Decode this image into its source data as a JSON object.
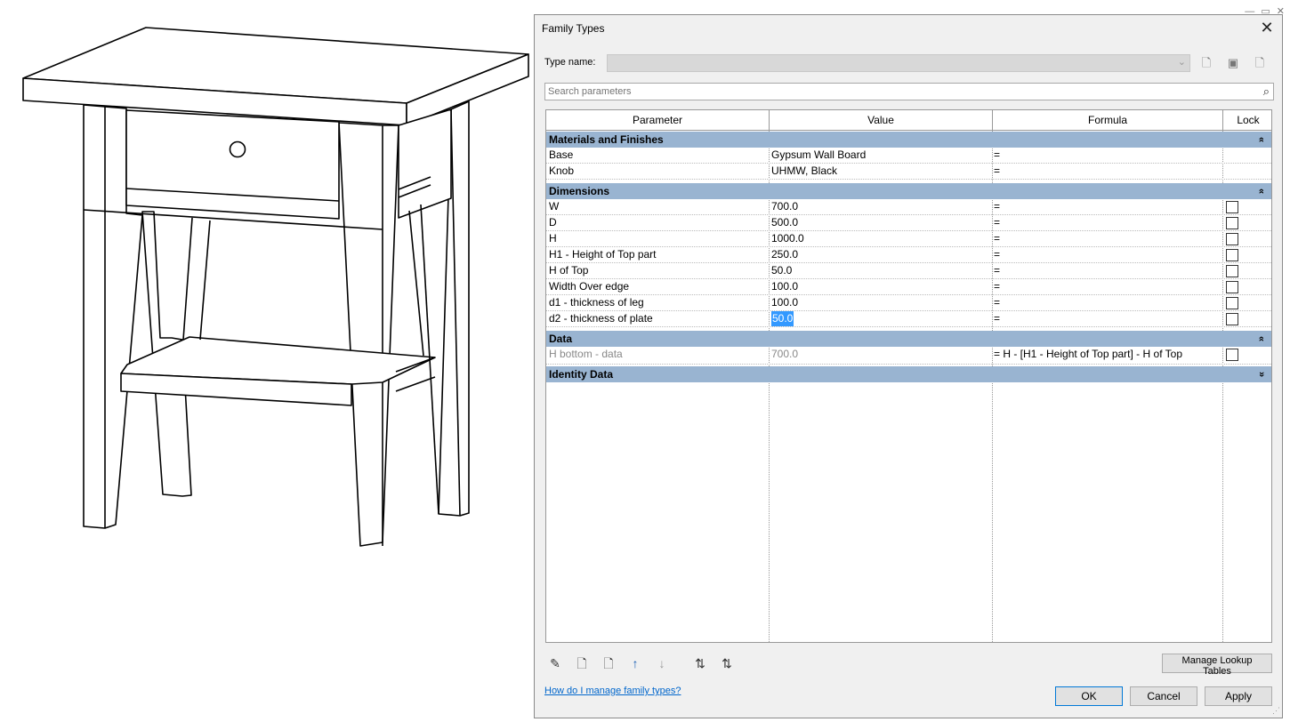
{
  "dialog": {
    "title": "Family Types",
    "close_glyph": "✕",
    "type_name_label": "Type name:",
    "type_name_value": "",
    "search_placeholder": "Search parameters",
    "columns": {
      "parameter": "Parameter",
      "value": "Value",
      "formula": "Formula",
      "lock": "Lock"
    },
    "groups": {
      "materials": {
        "title": "Materials and Finishes",
        "rows": [
          {
            "param": "Base",
            "value": "Gypsum Wall Board",
            "formula": "="
          },
          {
            "param": "Knob",
            "value": "UHMW, Black",
            "formula": "="
          }
        ]
      },
      "dimensions": {
        "title": "Dimensions",
        "rows": [
          {
            "param": "W",
            "value": "700.0",
            "formula": "="
          },
          {
            "param": "D",
            "value": "500.0",
            "formula": "="
          },
          {
            "param": "H",
            "value": "1000.0",
            "formula": "="
          },
          {
            "param": "H1 - Height of Top part",
            "value": "250.0",
            "formula": "="
          },
          {
            "param": "H of Top",
            "value": "50.0",
            "formula": "="
          },
          {
            "param": "Width Over edge",
            "value": "100.0",
            "formula": "="
          },
          {
            "param": "d1 - thickness of leg",
            "value": "100.0",
            "formula": "="
          },
          {
            "param": "d2 - thickness of plate",
            "value": "50.0",
            "formula": "="
          }
        ]
      },
      "data": {
        "title": "Data",
        "rows": [
          {
            "param": "H bottom - data",
            "value": "700.0",
            "formula": "= H - [H1 - Height of Top part] - H of Top"
          }
        ]
      },
      "identity": {
        "title": "Identity Data"
      }
    },
    "chevron_up": "»",
    "chevron_down": "»",
    "manage_lookup": "Manage Lookup Tables",
    "help_link": "How do I manage family types?",
    "ok": "OK",
    "cancel": "Cancel",
    "apply": "Apply"
  },
  "icons": {
    "new_type": "new-type-icon",
    "rename_type": "rename-type-icon",
    "delete_type": "delete-type-icon",
    "edit_parameter": "pencil-icon",
    "new_parameter": "new-parameter-icon",
    "delete_parameter": "delete-parameter-icon",
    "move_up": "move-up-icon",
    "move_down": "move-down-icon",
    "sort_ascending": "sort-ascending-icon",
    "sort_descending": "sort-descending-icon",
    "search": "search-icon"
  }
}
